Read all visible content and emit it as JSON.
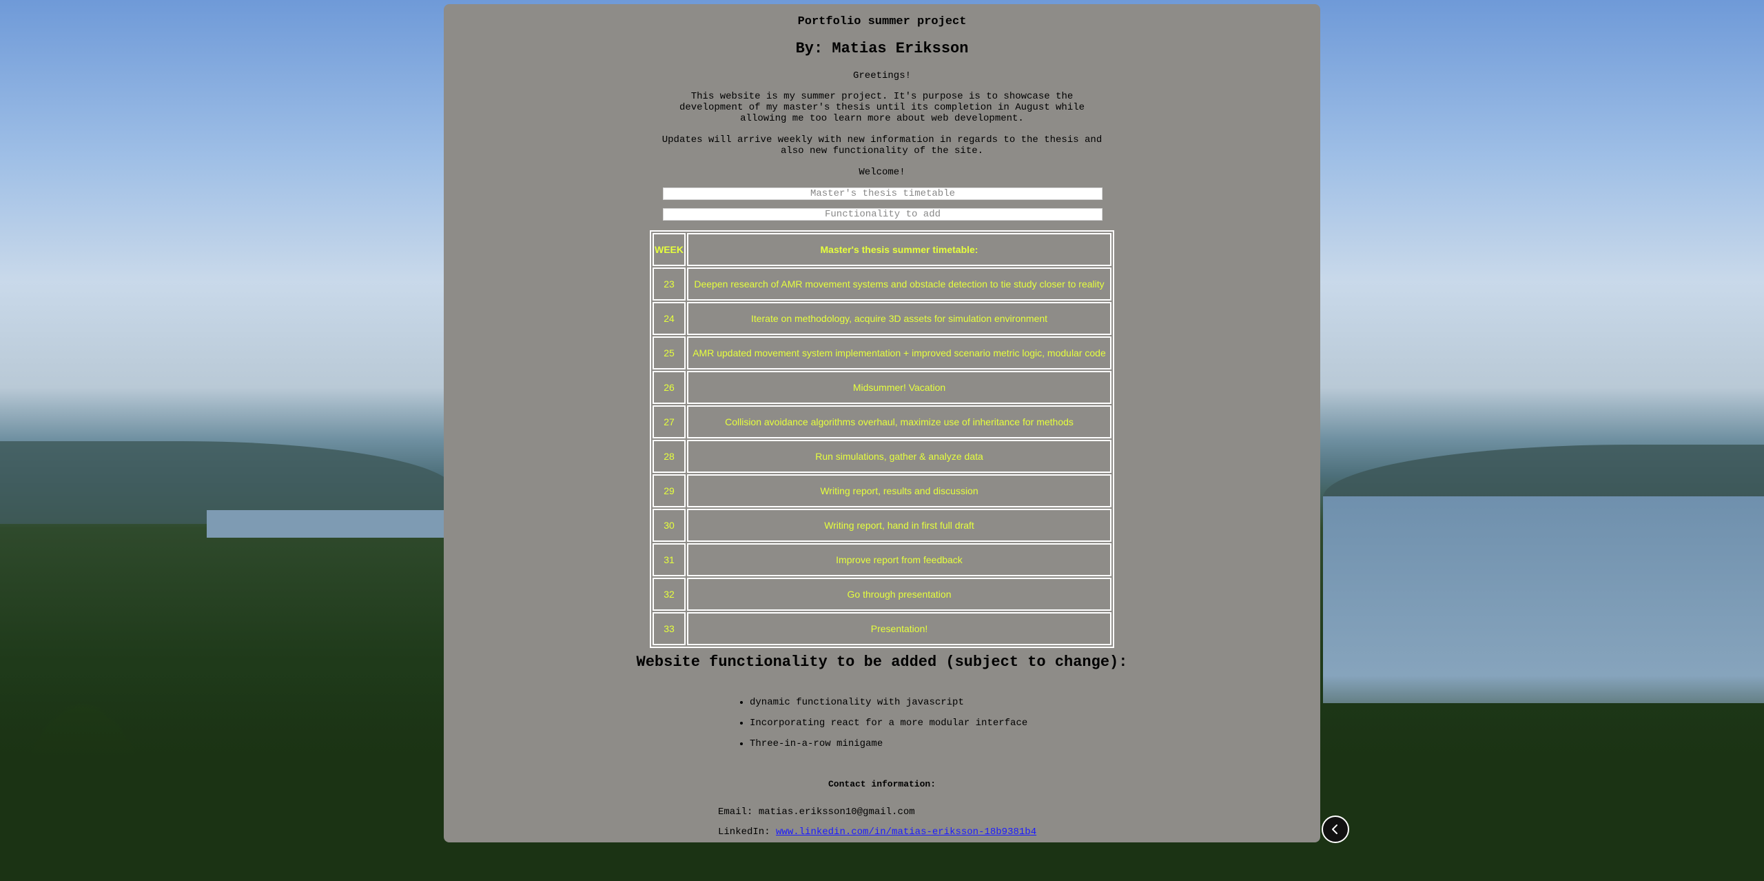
{
  "header": {
    "subtitle": "Portfolio summer project",
    "author": "By: Matias Eriksson"
  },
  "intro": {
    "greeting": "Greetings!",
    "paragraph1": "This website is my summer project. It's purpose is to showcase the development of my master's thesis until its completion in August while allowing me too learn more about web development.",
    "paragraph2": "Updates will arrive weekly with new information in regards to the thesis and also new functionality of the site.",
    "welcome": "Welcome!"
  },
  "toggles": {
    "timetable_label": "Master's thesis timetable",
    "functionality_label": "Functionality to add"
  },
  "timetable": {
    "header_week": "WEEK",
    "header_title": "Master's thesis summer timetable:",
    "rows": [
      {
        "week": "23",
        "task": "Deepen research of AMR movement systems and obstacle detection to tie study closer to reality"
      },
      {
        "week": "24",
        "task": "Iterate on methodology, acquire 3D assets for simulation environment"
      },
      {
        "week": "25",
        "task": "AMR updated movement system implementation + improved scenario metric logic, modular code"
      },
      {
        "week": "26",
        "task": "Midsummer! Vacation"
      },
      {
        "week": "27",
        "task": "Collision avoidance algorithms overhaul, maximize use of inheritance for methods"
      },
      {
        "week": "28",
        "task": "Run simulations, gather & analyze data"
      },
      {
        "week": "29",
        "task": "Writing report, results and discussion"
      },
      {
        "week": "30",
        "task": "Writing report, hand in first full draft"
      },
      {
        "week": "31",
        "task": "Improve report from feedback"
      },
      {
        "week": "32",
        "task": "Go through presentation"
      },
      {
        "week": "33",
        "task": "Presentation!"
      }
    ]
  },
  "functionality": {
    "heading": "Website functionality to be added (subject to change):",
    "items": [
      "dynamic functionality with javascript",
      "Incorporating react for a more modular interface",
      "Three-in-a-row minigame"
    ]
  },
  "contact": {
    "heading": "Contact information:",
    "email_label": "Email:",
    "email": "matias.eriksson10@gmail.com",
    "linkedin_label": "LinkedIn:",
    "linkedin": "www.linkedin.com/in/matias-eriksson-18b9381b4"
  },
  "colors": {
    "panel": "#8e8c88",
    "table_text": "#e6ff3d",
    "link": "#1a1aff"
  },
  "icons": {
    "back_button": "chevron-left-icon"
  }
}
